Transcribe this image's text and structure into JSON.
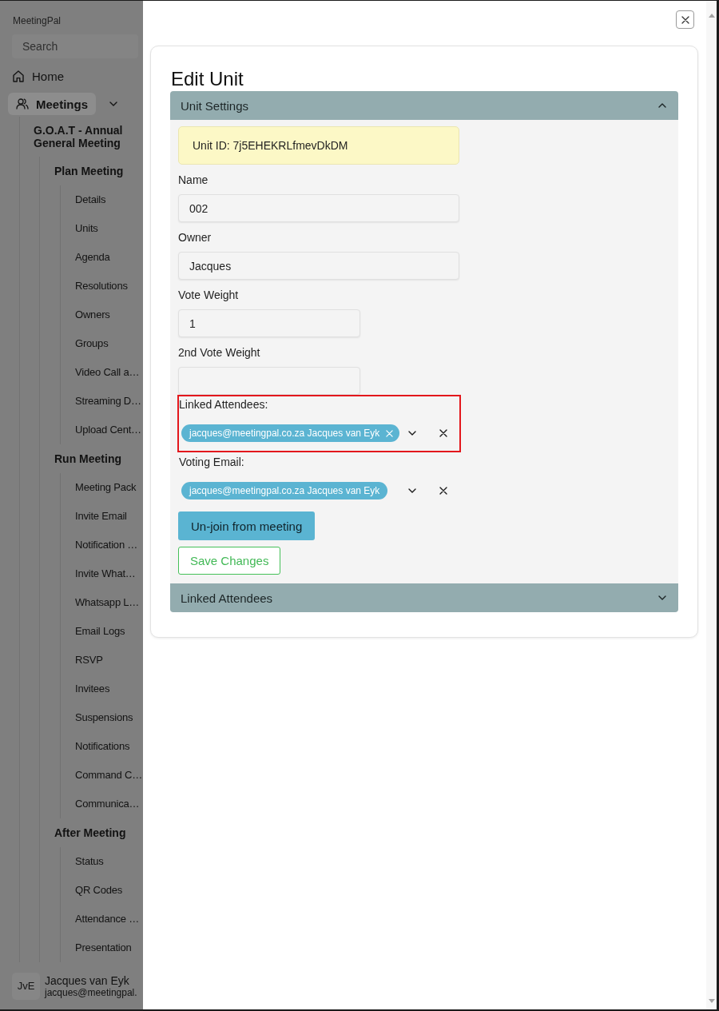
{
  "sidebar": {
    "app_name": "MeetingPal",
    "search": {
      "placeholder": "Search"
    },
    "home": {
      "label": "Home"
    },
    "meetings": {
      "label": "Meetings",
      "active": true,
      "expanded": true,
      "children": [
        {
          "label": "G.O.A.T - Annual General Meeting",
          "children": [
            {
              "label": "Plan Meeting",
              "children": [
                {
                  "label": "Details"
                },
                {
                  "label": "Units"
                },
                {
                  "label": "Agenda"
                },
                {
                  "label": "Resolutions"
                },
                {
                  "label": "Owners"
                },
                {
                  "label": "Groups"
                },
                {
                  "label": "Video Call a…"
                },
                {
                  "label": "Streaming D…"
                },
                {
                  "label": "Upload Cent…"
                }
              ]
            },
            {
              "label": "Run Meeting",
              "children": [
                {
                  "label": "Meeting Pack"
                },
                {
                  "label": "Invite Email"
                },
                {
                  "label": "Notification …"
                },
                {
                  "label": "Invite What…"
                },
                {
                  "label": "Whatsapp L…"
                },
                {
                  "label": "Email Logs"
                },
                {
                  "label": "RSVP"
                },
                {
                  "label": "Invitees"
                },
                {
                  "label": "Suspensions"
                },
                {
                  "label": "Notifications"
                },
                {
                  "label": "Command C…"
                },
                {
                  "label": "Communica…"
                }
              ]
            },
            {
              "label": "After Meeting",
              "children": [
                {
                  "label": "Status"
                },
                {
                  "label": "QR Codes"
                },
                {
                  "label": "Attendance …"
                },
                {
                  "label": "Presentation"
                }
              ]
            }
          ]
        }
      ]
    },
    "user": {
      "initials": "JvE",
      "name": "Jacques van Eyk",
      "email": "jacques@meetingpal."
    }
  },
  "drawer": {
    "title": "Edit Unit",
    "sections": [
      {
        "title": "Unit Settings",
        "expanded": true,
        "unit_id": "Unit ID: 7j5EHEKRLfmevDkDM",
        "fields": [
          {
            "kind": "text",
            "label": "Name",
            "value": "002"
          },
          {
            "kind": "text",
            "label": "Owner",
            "value": "Jacques"
          },
          {
            "kind": "number",
            "label": "Vote Weight",
            "value": "1"
          },
          {
            "kind": "number",
            "label": "2nd Vote Weight"
          }
        ],
        "selects": [
          {
            "label": "Linked Attendees:",
            "highlighted": true,
            "chips": [
              {
                "label": "jacques@meetingpal.co.za Jacques van Eyk",
                "removable": true
              }
            ]
          },
          {
            "label": "Voting Email:",
            "highlighted": false,
            "chips": [
              {
                "label": "jacques@meetingpal.co.za Jacques van Eyk",
                "removable": false
              }
            ]
          }
        ],
        "buttons": [
          {
            "kind": "primary",
            "label": "Un-join from meeting"
          },
          {
            "kind": "outline",
            "label": "Save Changes"
          }
        ]
      },
      {
        "title": "Linked Attendees",
        "expanded": false
      }
    ]
  }
}
